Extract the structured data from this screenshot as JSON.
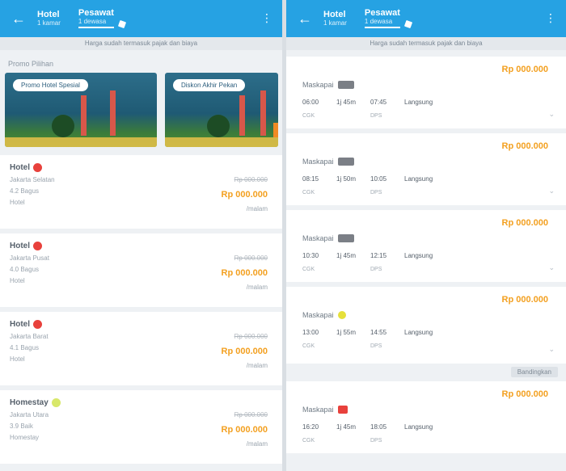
{
  "left": {
    "topbar": {
      "back_icon": "arrow-left-icon",
      "tabs": [
        {
          "main": "Hotel",
          "sub": "1 kamar"
        },
        {
          "main": "Pesawat",
          "sub": "1 dewasa"
        }
      ],
      "more_icon": "more-vertical-icon"
    },
    "notice": "Harga sudah termasuk pajak dan biaya",
    "section_label": "Promo Pilihan",
    "promos": [
      {
        "pill": "Promo Hotel Spesial"
      },
      {
        "pill": "Diskon Akhir Pekan"
      }
    ],
    "hotels": [
      {
        "name": "Hotel",
        "badge_color": "#e8413c",
        "area": "Jakarta Selatan",
        "rating": "4.2 Bagus",
        "type": "Hotel",
        "old_price": "Rp 000.000",
        "price": "Rp 000.000",
        "unit": "/malam"
      },
      {
        "name": "Hotel",
        "badge_color": "#e8413c",
        "area": "Jakarta Pusat",
        "rating": "4.0 Bagus",
        "type": "Hotel",
        "old_price": "Rp 000.000",
        "price": "Rp 000.000",
        "unit": "/malam"
      },
      {
        "name": "Hotel",
        "badge_color": "#e8413c",
        "area": "Jakarta Barat",
        "rating": "4.1 Bagus",
        "type": "Hotel",
        "old_price": "Rp 000.000",
        "price": "Rp 000.000",
        "unit": "/malam"
      },
      {
        "name": "Homestay",
        "badge_color": "#d8e86a",
        "area": "Jakarta Utara",
        "rating": "3.9 Baik",
        "type": "Homestay",
        "old_price": "Rp 000.000",
        "price": "Rp 000.000",
        "unit": "/malam"
      }
    ]
  },
  "right": {
    "topbar": {
      "back_icon": "arrow-left-icon",
      "tabs": [
        {
          "main": "Hotel",
          "sub": "1 kamar"
        },
        {
          "main": "Pesawat",
          "sub": "1 dewasa"
        }
      ],
      "more_icon": "more-vertical-icon"
    },
    "notice": "Harga sudah termasuk pajak dan biaya",
    "compare_label": "Bandingkan",
    "flights": [
      {
        "price": "Rp 000.000",
        "airline": "Maskapai",
        "logo_color": "#7b7f86",
        "dep": "06:00",
        "dur": "1j 45m",
        "arr": "07:45",
        "stop": "Langsung",
        "dep_code": "CGK",
        "dur_code": "",
        "arr_code": "DPS",
        "stop_code": ""
      },
      {
        "price": "Rp 000.000",
        "airline": "Maskapai",
        "logo_color": "#7b7f86",
        "dep": "08:15",
        "dur": "1j 50m",
        "arr": "10:05",
        "stop": "Langsung",
        "dep_code": "CGK",
        "dur_code": "",
        "arr_code": "DPS",
        "stop_code": ""
      },
      {
        "price": "Rp 000.000",
        "airline": "Maskapai",
        "logo_color": "#7b7f86",
        "dep": "10:30",
        "dur": "1j 45m",
        "arr": "12:15",
        "stop": "Langsung",
        "dep_code": "CGK",
        "dur_code": "",
        "arr_code": "DPS",
        "stop_code": ""
      },
      {
        "price": "Rp 000.000",
        "airline": "Maskapai",
        "logo_color": "#e6e03a",
        "dep": "13:00",
        "dur": "1j 55m",
        "arr": "14:55",
        "stop": "Langsung",
        "dep_code": "CGK",
        "dur_code": "",
        "arr_code": "DPS",
        "stop_code": ""
      },
      {
        "price": "Rp 000.000",
        "airline": "Maskapai",
        "logo_color": "#e8413c",
        "dep": "16:20",
        "dur": "1j 45m",
        "arr": "18:05",
        "stop": "Langsung",
        "dep_code": "CGK",
        "dur_code": "",
        "arr_code": "DPS",
        "stop_code": ""
      }
    ]
  }
}
